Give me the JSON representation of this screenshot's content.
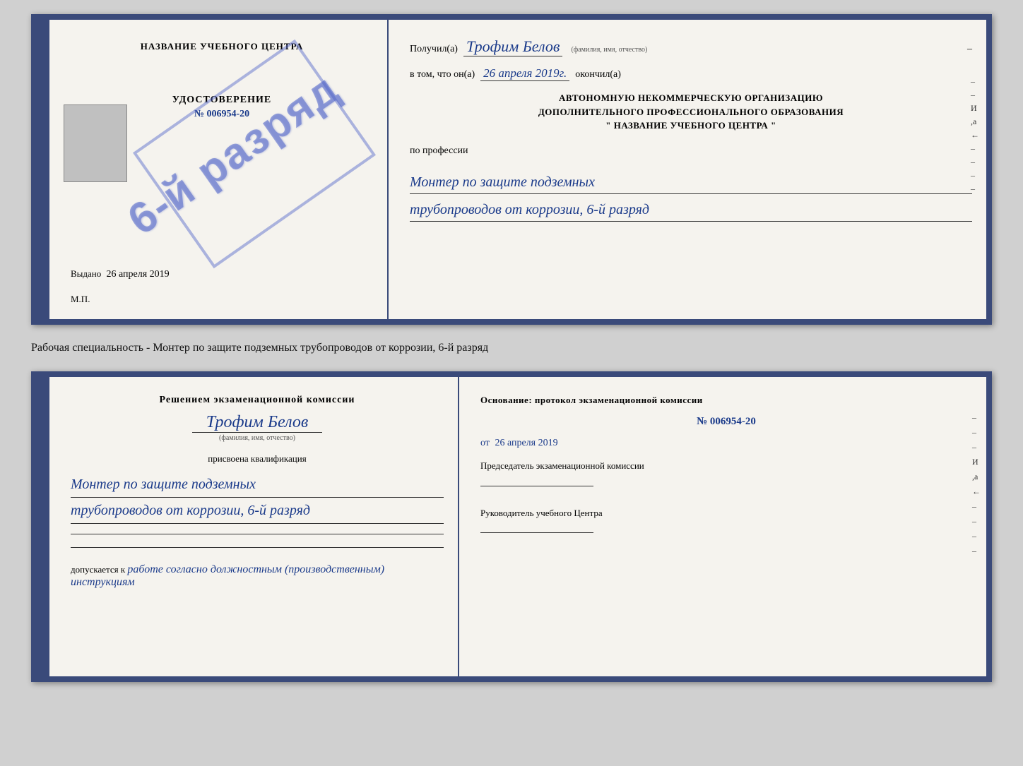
{
  "top_cert": {
    "org_name": "НАЗВАНИЕ УЧЕБНОГО ЦЕНТРА",
    "stamp_text": "6-й разряд",
    "udostoverenie_label": "УДОСТОВЕРЕНИЕ",
    "number": "№ 006954-20",
    "vydano_label": "Выдано",
    "vydano_date": "26 апреля 2019",
    "mp_label": "М.П.",
    "poluchil_label": "Получил(а)",
    "recipient_name": "Трофим Белов",
    "fio_subtitle": "(фамилия, имя, отчество)",
    "dash": "–",
    "vtom_label": "в том, что он(а)",
    "completed_date": "26 апреля 2019г.",
    "okonchil_label": "окончил(а)",
    "org_line1": "АВТОНОМНУЮ НЕКОММЕРЧЕСКУЮ ОРГАНИЗАЦИЮ",
    "org_line2": "ДОПОЛНИТЕЛЬНОГО ПРОФЕССИОНАЛЬНОГО ОБРАЗОВАНИЯ",
    "org_line3": "\"  НАЗВАНИЕ УЧЕБНОГО ЦЕНТРА  \"",
    "po_professii": "по профессии",
    "profession_line1": "Монтер по защите подземных",
    "profession_line2": "трубопроводов от коррозии, 6-й разряд",
    "side_chars": [
      "–",
      "–",
      "И",
      ",а",
      "←",
      "–",
      "–",
      "–",
      "–"
    ]
  },
  "middle_label": {
    "text": "Рабочая специальность - Монтер по защите подземных трубопроводов от коррозии, 6-й разряд"
  },
  "bottom_cert": {
    "resheniem_label": "Решением экзаменационной комиссии",
    "recipient_name": "Трофим Белов",
    "fio_subtitle": "(фамилия, имя, отчество)",
    "prisvoena_label": "присвоена квалификация",
    "profession_line1": "Монтер по защите подземных",
    "profession_line2": "трубопроводов от коррозии, 6-й разряд",
    "dopuskaetsya_label": "допускается к",
    "dopuskaetsya_value": "работе согласно должностным (производственным) инструкциям",
    "osnovanie_label": "Основание: протокол экзаменационной комиссии",
    "protocol_num": "№  006954-20",
    "ot_label": "от",
    "ot_date": "26 апреля 2019",
    "predsedatel_label": "Председатель экзаменационной комиссии",
    "rukovoditel_label": "Руководитель учебного Центра",
    "side_chars": [
      "–",
      "–",
      "–",
      "И",
      ",а",
      "←",
      "–",
      "–",
      "–",
      "–"
    ]
  }
}
